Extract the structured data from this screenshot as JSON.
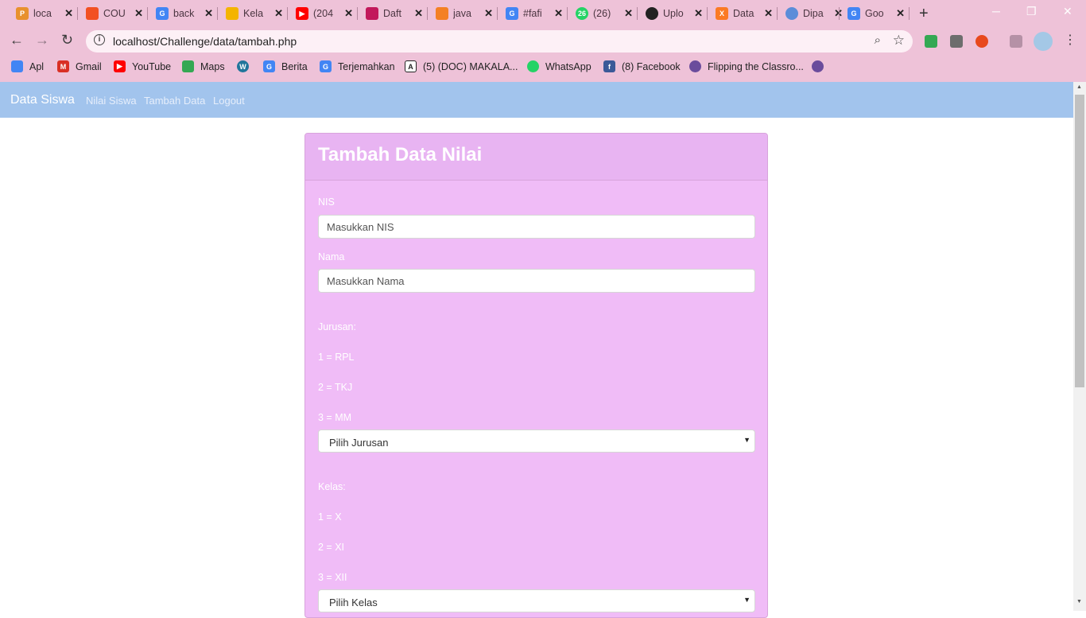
{
  "browser": {
    "tabs": [
      {
        "title": "loca",
        "icon": "pma-icon",
        "color": "#e8912d"
      },
      {
        "title": "COU",
        "icon": "microsoft-icon",
        "color": "#f25022"
      },
      {
        "title": "back",
        "icon": "google-icon",
        "color": "#4285f4"
      },
      {
        "title": "Kela",
        "icon": "classroom-icon",
        "color": "#f4b400"
      },
      {
        "title": "(204",
        "icon": "youtube-icon",
        "color": "#ff0000"
      },
      {
        "title": "Daft",
        "icon": "daft-icon",
        "color": "#c2185b"
      },
      {
        "title": "java",
        "icon": "stackoverflow-icon",
        "color": "#f48024"
      },
      {
        "title": "#fafi",
        "icon": "google-icon",
        "color": "#4285f4"
      },
      {
        "title": "(26)",
        "icon": "whatsapp-icon",
        "color": "#25d366"
      },
      {
        "title": "Uplo",
        "icon": "github-icon",
        "color": "#222222"
      },
      {
        "title": "Data",
        "icon": "xampp-icon",
        "color": "#fb7a24"
      },
      {
        "title": "Dipa",
        "icon": "globe-icon",
        "color": "#5b8dd9"
      },
      {
        "title": "Goo",
        "icon": "google-icon",
        "color": "#4285f4"
      }
    ],
    "url": "localhost/Challenge/data/tambah.php",
    "bookmarks": [
      {
        "label": "Apl",
        "icon": "apps-icon",
        "color": "#4285f4"
      },
      {
        "label": "Gmail",
        "icon": "gmail-icon",
        "color": "#d93025"
      },
      {
        "label": "YouTube",
        "icon": "youtube-icon",
        "color": "#ff0000"
      },
      {
        "label": "Maps",
        "icon": "maps-icon",
        "color": "#34a853"
      },
      {
        "label": "",
        "icon": "wordpress-icon",
        "color": "#21759b"
      },
      {
        "label": "Berita",
        "icon": "news-icon",
        "color": "#4285f4"
      },
      {
        "label": "Terjemahkan",
        "icon": "translate-icon",
        "color": "#4285f4"
      },
      {
        "label": "(5) (DOC) MAKALA...",
        "icon": "academia-icon",
        "color": "#222222"
      },
      {
        "label": "WhatsApp",
        "icon": "whatsapp-icon",
        "color": "#25d366"
      },
      {
        "label": "(8) Facebook",
        "icon": "facebook-icon",
        "color": "#3b5998"
      },
      {
        "label": "Flipping the Classro...",
        "icon": "globe-icon",
        "color": "#6a4c9c"
      },
      {
        "label": "",
        "icon": "globe-icon",
        "color": "#6a4c9c"
      }
    ],
    "tab_badges": {
      "whatsapp": "26"
    }
  },
  "navbar": {
    "brand": "Data Siswa",
    "links": [
      "Nilai Siswa",
      "Tambah Data",
      "Logout"
    ]
  },
  "form": {
    "title": "Tambah Data Nilai",
    "nis_label": "NIS",
    "nis_placeholder": "Masukkan NIS",
    "nama_label": "Nama",
    "nama_placeholder": "Masukkan Nama",
    "jurusan_label": "Jurusan:",
    "jurusan_options": [
      "1 = RPL",
      "2 = TKJ",
      "3 = MM"
    ],
    "jurusan_select": "Pilih Jurusan",
    "kelas_label": "Kelas:",
    "kelas_options": [
      "1 = X",
      "2 = XI",
      "3 = XII"
    ],
    "kelas_select": "Pilih Kelas"
  },
  "colors": {
    "navbar": "#a2c4ed",
    "panel": "#f0bcf7",
    "panel_header": "#e8b4f2",
    "chrome_frame": "#eec2d8"
  }
}
